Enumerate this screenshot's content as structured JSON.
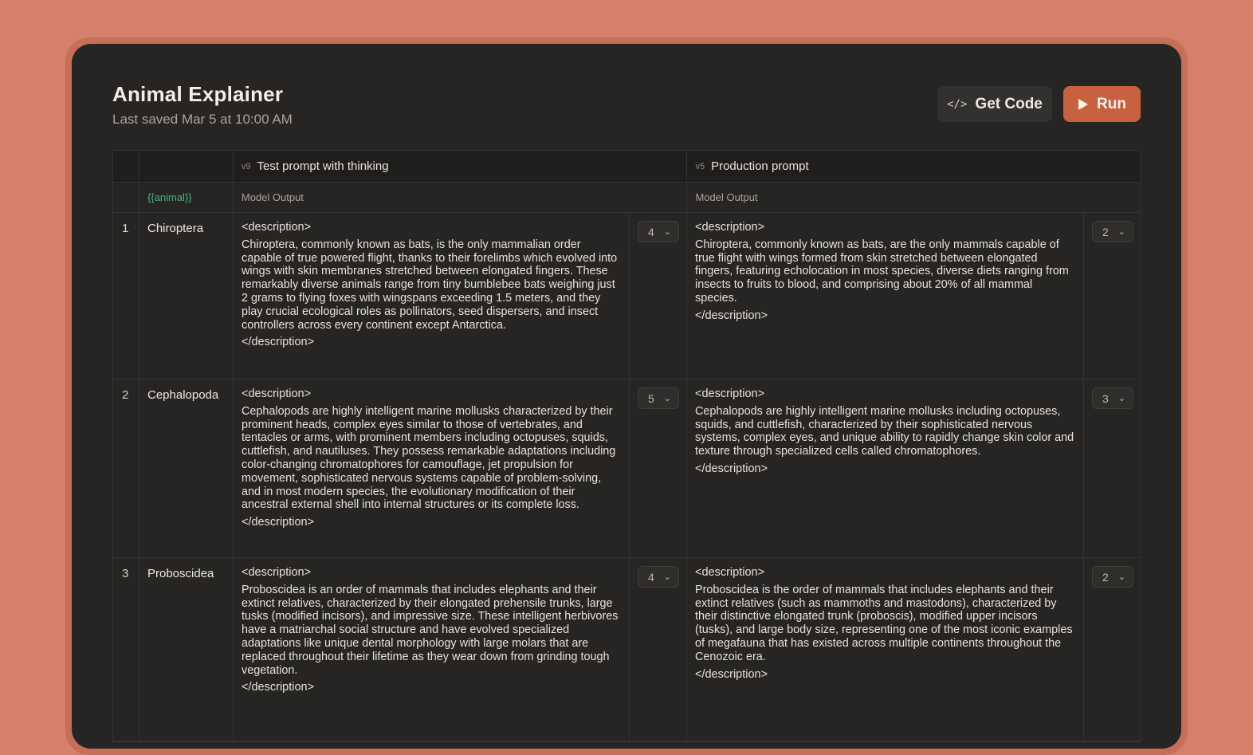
{
  "header": {
    "title": "Animal Explainer",
    "saved": "Last saved Mar 5 at 10:00 AM",
    "get_code_label": "Get Code",
    "run_label": "Run"
  },
  "columns": {
    "a": {
      "version": "v9",
      "name": "Test prompt with thinking"
    },
    "b": {
      "version": "v5",
      "name": "Production prompt"
    },
    "variable": "{{animal}}",
    "output_label": "Model Output"
  },
  "rows": [
    {
      "num": "1",
      "animal": "Chiroptera",
      "a": {
        "open": "<description>",
        "text": "Chiroptera, commonly known as bats, is the only mammalian order capable of true powered flight, thanks to their forelimbs which evolved into wings with skin membranes stretched between elongated fingers. These remarkably diverse animals range from tiny bumblebee bats weighing just 2 grams to flying foxes with wingspans exceeding 1.5 meters, and they play crucial ecological roles as pollinators, seed dispersers, and insect controllers across every continent except Antarctica.",
        "close": "</description>",
        "score": "4"
      },
      "b": {
        "open": "<description>",
        "text": "Chiroptera, commonly known as bats, are the only mammals capable of true flight with wings formed from skin stretched between elongated fingers, featuring echolocation in most species, diverse diets ranging from insects to fruits to blood, and comprising about 20% of all mammal species.",
        "close": "</description>",
        "score": "2"
      }
    },
    {
      "num": "2",
      "animal": "Cephalopoda",
      "a": {
        "open": "<description>",
        "text": "Cephalopods are highly intelligent marine mollusks characterized by their prominent heads, complex eyes similar to those of vertebrates, and tentacles or arms, with prominent members including octopuses, squids, cuttlefish, and nautiluses. They possess remarkable adaptations including color-changing chromatophores for camouflage, jet propulsion for movement, sophisticated nervous systems capable of problem-solving, and in most modern species, the evolutionary modification of their ancestral external shell into internal structures or its complete loss.",
        "close": "</description>",
        "score": "5"
      },
      "b": {
        "open": "<description>",
        "text": "Cephalopods are highly intelligent marine mollusks including octopuses, squids, and cuttlefish, characterized by their sophisticated nervous systems, complex eyes, and unique ability to rapidly change skin color and texture through specialized cells called chromatophores.",
        "close": "</description>",
        "score": "3"
      }
    },
    {
      "num": "3",
      "animal": "Proboscidea",
      "a": {
        "open": "<description>",
        "text": "Proboscidea is an order of mammals that includes elephants and their extinct relatives, characterized by their elongated prehensile trunks, large tusks (modified incisors), and impressive size. These intelligent herbivores have a matriarchal social structure and have evolved specialized adaptations like unique dental morphology with large molars that are replaced throughout their lifetime as they wear down from grinding tough vegetation.",
        "close": "</description>",
        "score": "4"
      },
      "b": {
        "open": "<description>",
        "text": "Proboscidea is the order of mammals that includes elephants and their extinct relatives (such as mammoths and mastodons), characterized by their distinctive elongated trunk (proboscis), modified upper incisors (tusks), and large body size, representing one of the most iconic examples of megafauna that has existed across multiple continents throughout the Cenozoic era.",
        "close": "</description>",
        "score": "2"
      }
    }
  ],
  "icons": {
    "code": "code-icon",
    "run": "play-icon",
    "chevron": "chevron-down-icon"
  },
  "colors": {
    "background": "#D4806A",
    "window": "#262524",
    "run_button": "#C7623E",
    "variable": "#4FB27D"
  }
}
